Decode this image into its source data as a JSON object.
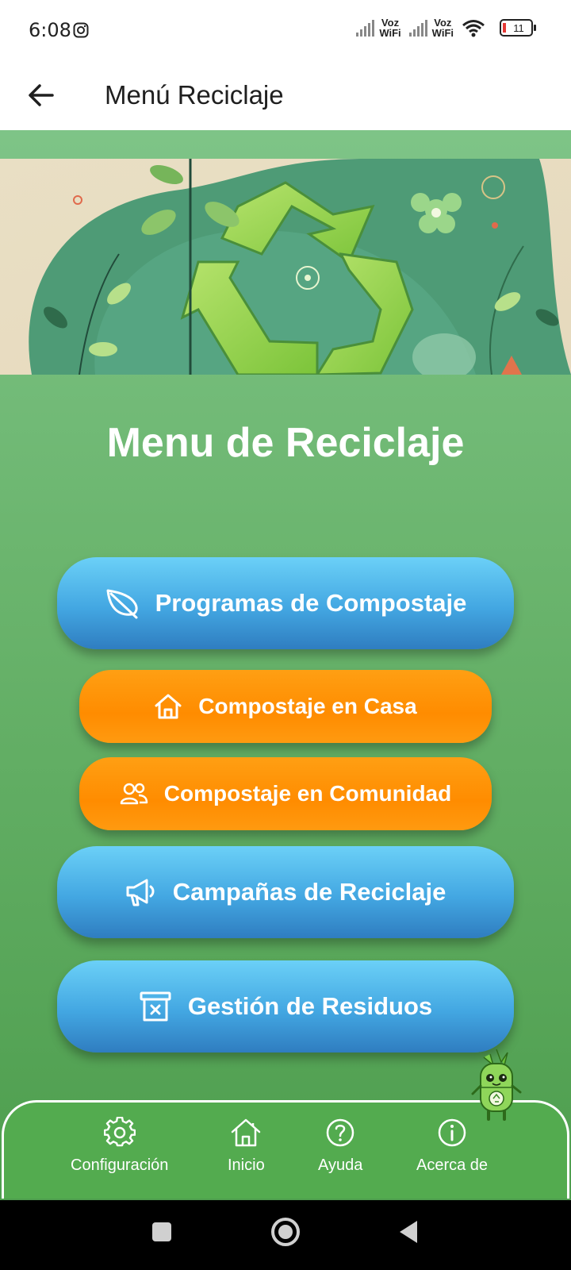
{
  "status": {
    "time": "6:08",
    "voz1_top": "Voz",
    "voz1_bottom": "WiFi",
    "voz2_top": "Voz",
    "voz2_bottom": "WiFi",
    "battery": "11"
  },
  "appbar": {
    "title": "Menú Reciclaje"
  },
  "main": {
    "title": "Menu de Reciclaje",
    "buttons": [
      {
        "label": "Programas de Compostaje",
        "icon": "leaf-icon"
      },
      {
        "label": "Compostaje en Casa",
        "icon": "home-icon"
      },
      {
        "label": "Compostaje en Comunidad",
        "icon": "people-icon"
      },
      {
        "label": "Campañas de Reciclaje",
        "icon": "megaphone-icon"
      },
      {
        "label": "Gestión de Residuos",
        "icon": "trash-icon"
      }
    ]
  },
  "bottom_nav": {
    "items": [
      {
        "label": "Configuración",
        "icon": "gear-icon"
      },
      {
        "label": "Inicio",
        "icon": "home-icon"
      },
      {
        "label": "Ayuda",
        "icon": "help-icon"
      },
      {
        "label": "Acerca de",
        "icon": "info-icon"
      }
    ]
  },
  "colors": {
    "background_green": "#6bb56e",
    "button_blue": "#43a7e2",
    "button_orange": "#ff8c00",
    "nav_green": "#53ab4f"
  }
}
